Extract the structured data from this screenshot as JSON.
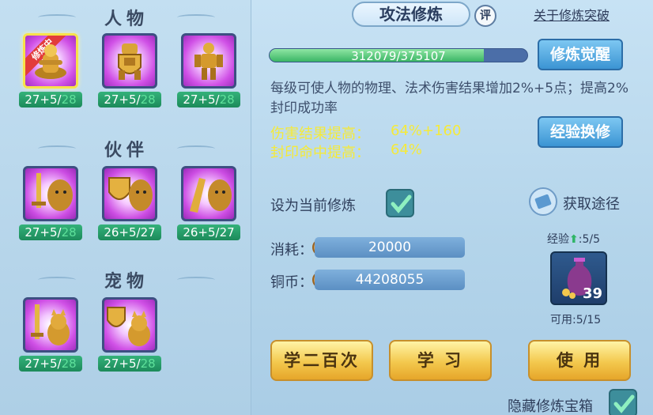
{
  "left": {
    "sections": [
      {
        "title": "人物"
      },
      {
        "title": "伙伴"
      },
      {
        "title": "宠物"
      }
    ],
    "slots": [
      {
        "name": "char-1",
        "base": "27+5/",
        "max": "28",
        "ribbon": "修炼中"
      },
      {
        "name": "char-2",
        "base": "27+5/",
        "max": "28"
      },
      {
        "name": "char-3",
        "base": "27+5/",
        "max": "28"
      },
      {
        "name": "partner-1",
        "base": "27+5/",
        "max": "28"
      },
      {
        "name": "partner-2",
        "base": "26+5/",
        "max": "27"
      },
      {
        "name": "partner-3",
        "base": "26+5/",
        "max": "27"
      },
      {
        "name": "pet-1",
        "base": "27+5/",
        "max": "28"
      },
      {
        "name": "pet-2",
        "base": "27+5/",
        "max": "28"
      }
    ]
  },
  "header": {
    "title": "攻法修炼",
    "ping": "评",
    "about": "关于修炼突破"
  },
  "progress": {
    "text": "312079/375107",
    "current": 312079,
    "total": 375107
  },
  "buttons": {
    "awaken": "修炼觉醒",
    "exchange": "经验换修",
    "get": "获取途径",
    "learn200": "学二百次",
    "learn": "学 习",
    "use": "使 用"
  },
  "description": "每级可使人物的物理、法术伤害结果增加2%+5点；提高2%封印成功率",
  "stats": [
    {
      "label": "伤害结果提高：",
      "value": "64%+160"
    },
    {
      "label": "封印命中提高：",
      "value": "64%"
    }
  ],
  "set_current": {
    "label": "设为当前修炼",
    "checked": true
  },
  "cost": {
    "label": "消耗：",
    "value": "20000"
  },
  "coins": {
    "label": "铜币：",
    "value": "44208055"
  },
  "exp": {
    "label": "经验",
    "value": ":5/5",
    "count": "39",
    "available": "可用:5/15"
  },
  "hide": {
    "label": "隐藏修炼宝箱",
    "checked": true
  },
  "colors": {
    "accent": "#3b94d3",
    "stat": "#f5ea3a",
    "gold": "#f3c84d"
  }
}
